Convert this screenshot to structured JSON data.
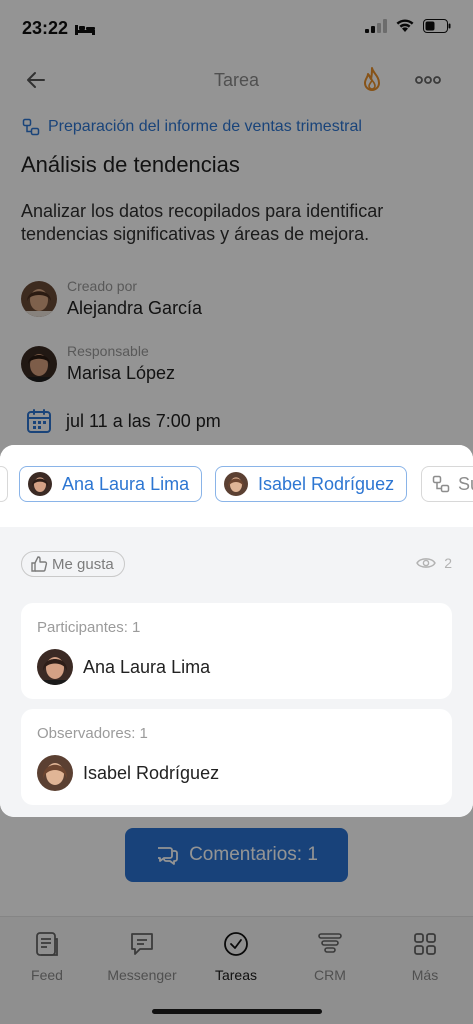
{
  "status_bar": {
    "time": "23:22"
  },
  "nav": {
    "title": "Tarea"
  },
  "task": {
    "parent_link": "Preparación del informe de ventas trimestral",
    "title": "Análisis de tendencias",
    "description": "Analizar los datos recopilados para identificar tendencias significativas y áreas de mejora.",
    "creator_label": "Creado por",
    "creator_name": "Alejandra García",
    "responsible_label": "Responsable",
    "responsible_name": "Marisa López",
    "deadline": "jul 11 a las 7:00 pm"
  },
  "sheet": {
    "chips": [
      "Ana Laura Lima",
      "Isabel Rodríguez"
    ],
    "partial_chip": "Su",
    "like_label": "Me gusta",
    "views_count": "2",
    "participants_title": "Participantes: 1",
    "participant_name": "Ana Laura Lima",
    "observers_title": "Observadores: 1",
    "observer_name": "Isabel Rodríguez"
  },
  "comments_button": "Comentarios: 1",
  "tabbar": {
    "tabs": [
      {
        "label": "Feed",
        "icon": "feed-icon"
      },
      {
        "label": "Messenger",
        "icon": "chat-icon"
      },
      {
        "label": "Tareas",
        "icon": "check-circle-icon",
        "active": true
      },
      {
        "label": "CRM",
        "icon": "filter-icon"
      },
      {
        "label": "Más",
        "icon": "grid-icon"
      }
    ]
  },
  "colors": {
    "accent": "#2d76d2",
    "button": "#2a73d2",
    "fire": "#e8902a"
  }
}
